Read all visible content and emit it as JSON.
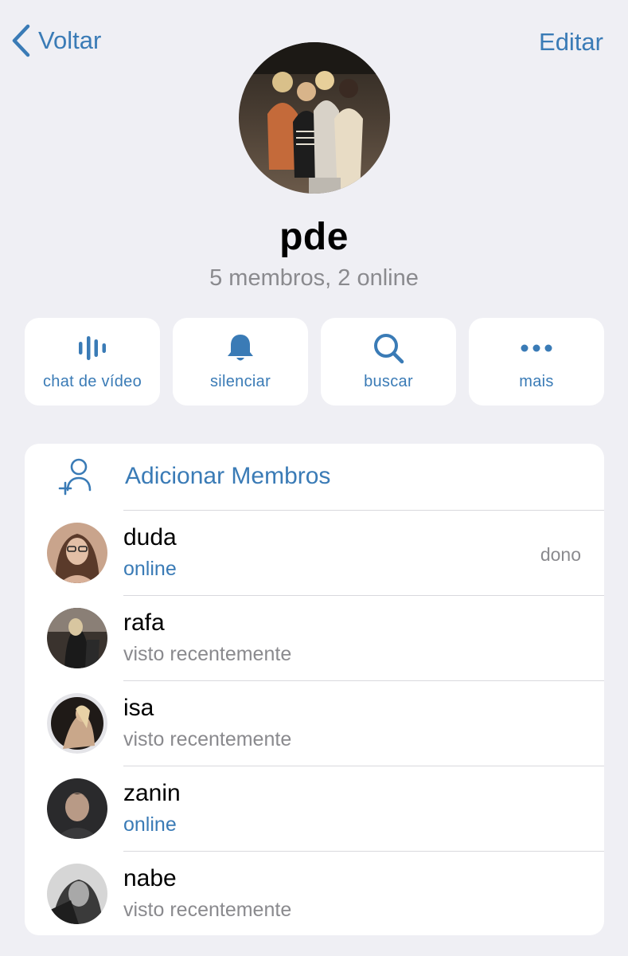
{
  "header": {
    "back_label": "Voltar",
    "edit_label": "Editar"
  },
  "group": {
    "name": "pde",
    "subtitle": "5 membros, 2 online"
  },
  "actions": [
    {
      "label": "chat de vídeo",
      "icon": "voice-chat-icon"
    },
    {
      "label": "silenciar",
      "icon": "bell-icon"
    },
    {
      "label": "buscar",
      "icon": "search-icon"
    },
    {
      "label": "mais",
      "icon": "more-icon"
    }
  ],
  "members_card": {
    "add_label": "Adicionar Membros",
    "members": [
      {
        "name": "duda",
        "status": "online",
        "role": "dono"
      },
      {
        "name": "rafa",
        "status": "visto recentemente"
      },
      {
        "name": "isa",
        "status": "visto recentemente"
      },
      {
        "name": "zanin",
        "status": "online"
      },
      {
        "name": "nabe",
        "status": "visto recentemente"
      }
    ]
  },
  "colors": {
    "accent": "#3a7bb6",
    "background": "#efeff4",
    "secondary_text": "#8a8a8e"
  }
}
